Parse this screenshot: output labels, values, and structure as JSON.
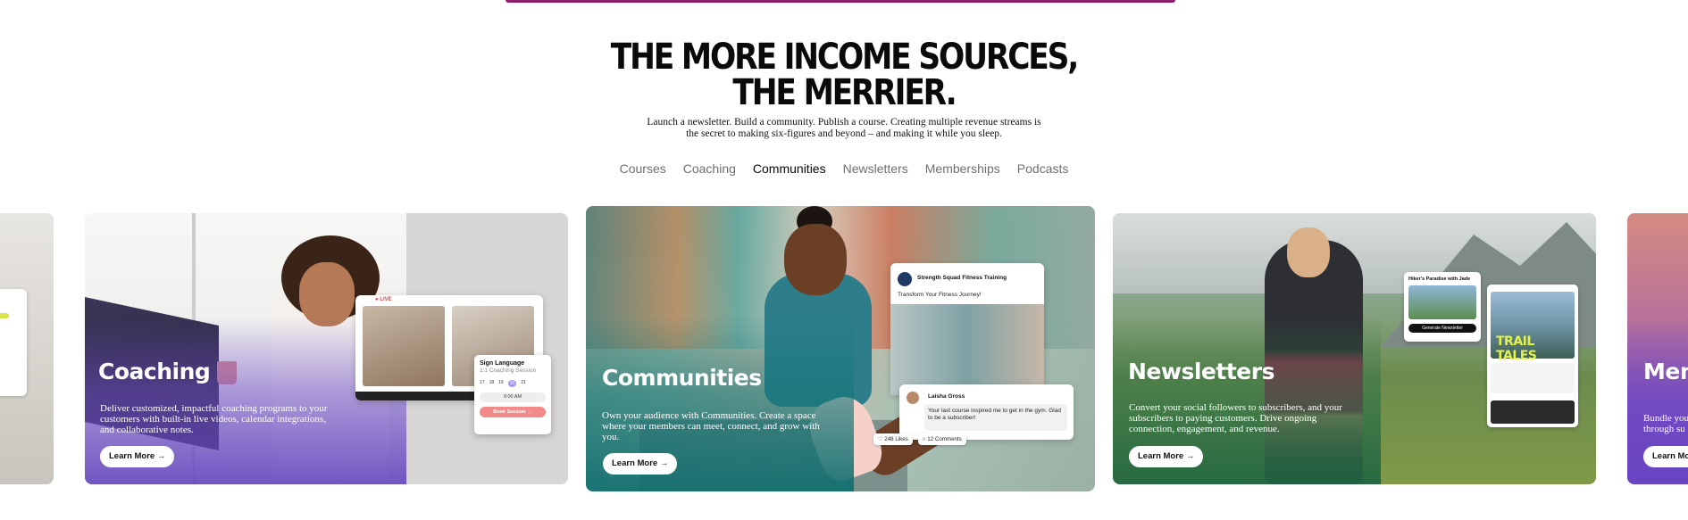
{
  "headline": {
    "line1": "THE MORE INCOME SOURCES,",
    "line2": "THE MERRIER."
  },
  "subtitle": {
    "line1": "Launch a newsletter. Build a community. Publish a course. Creating multiple revenue streams is",
    "line2": "the secret to making six-figures and beyond – and making it while you sleep."
  },
  "tabs": [
    {
      "label": "Courses",
      "active": false
    },
    {
      "label": "Coaching",
      "active": false
    },
    {
      "label": "Communities",
      "active": true
    },
    {
      "label": "Newsletters",
      "active": false
    },
    {
      "label": "Memberships",
      "active": false
    },
    {
      "label": "Podcasts",
      "active": false
    }
  ],
  "cards": {
    "coaching": {
      "title": "Coaching",
      "description": "Deliver customized, impactful coaching programs to your customers with built-in live videos, calendar integrations, and collaborative notes.",
      "button": "Learn More →",
      "mockup": {
        "live": "● LIVE",
        "booking_title": "Sign Language",
        "booking_subtitle": "1:1 Coaching Session",
        "days": [
          "17",
          "18",
          "19",
          "20",
          "21"
        ],
        "time": "9:00 AM",
        "book": "Book Session →"
      }
    },
    "communities": {
      "title": "Communities",
      "description": "Own your audience with Communities. Create a space where your members can meet, connect, and grow with you.",
      "button": "Learn More →",
      "mockup": {
        "group_name": "Strength Squad Fitness Training",
        "post_text": "Transform Your Fitness Journey!",
        "commenter": "Laisha Gross",
        "comment": "Your last course inspired me to get in the gym. Glad to be a subscriber!",
        "likes": "248 Likes",
        "comments": "12 Comments"
      }
    },
    "newsletters": {
      "title": "Newsletters",
      "description": "Convert your social followers to subscribers, and your subscribers to paying customers. Drive ongoing connection, engagement, and revenue.",
      "button": "Learn More →",
      "mockup": {
        "newsletter_title": "Hiker's Paradise with Jade",
        "generate": "Generate Newsletter",
        "hero_title": "TRAIL TALES"
      }
    },
    "memberships": {
      "title": "Mem",
      "description_line1": "Bundle you",
      "description_line2": "through su",
      "button": "Learn Mo"
    }
  },
  "colors": {
    "top_accent": "#8e1f6e",
    "coaching_gradient": "#7050c8",
    "communities_gradient": "#147878",
    "newsletters_gradient": "#286e46"
  }
}
